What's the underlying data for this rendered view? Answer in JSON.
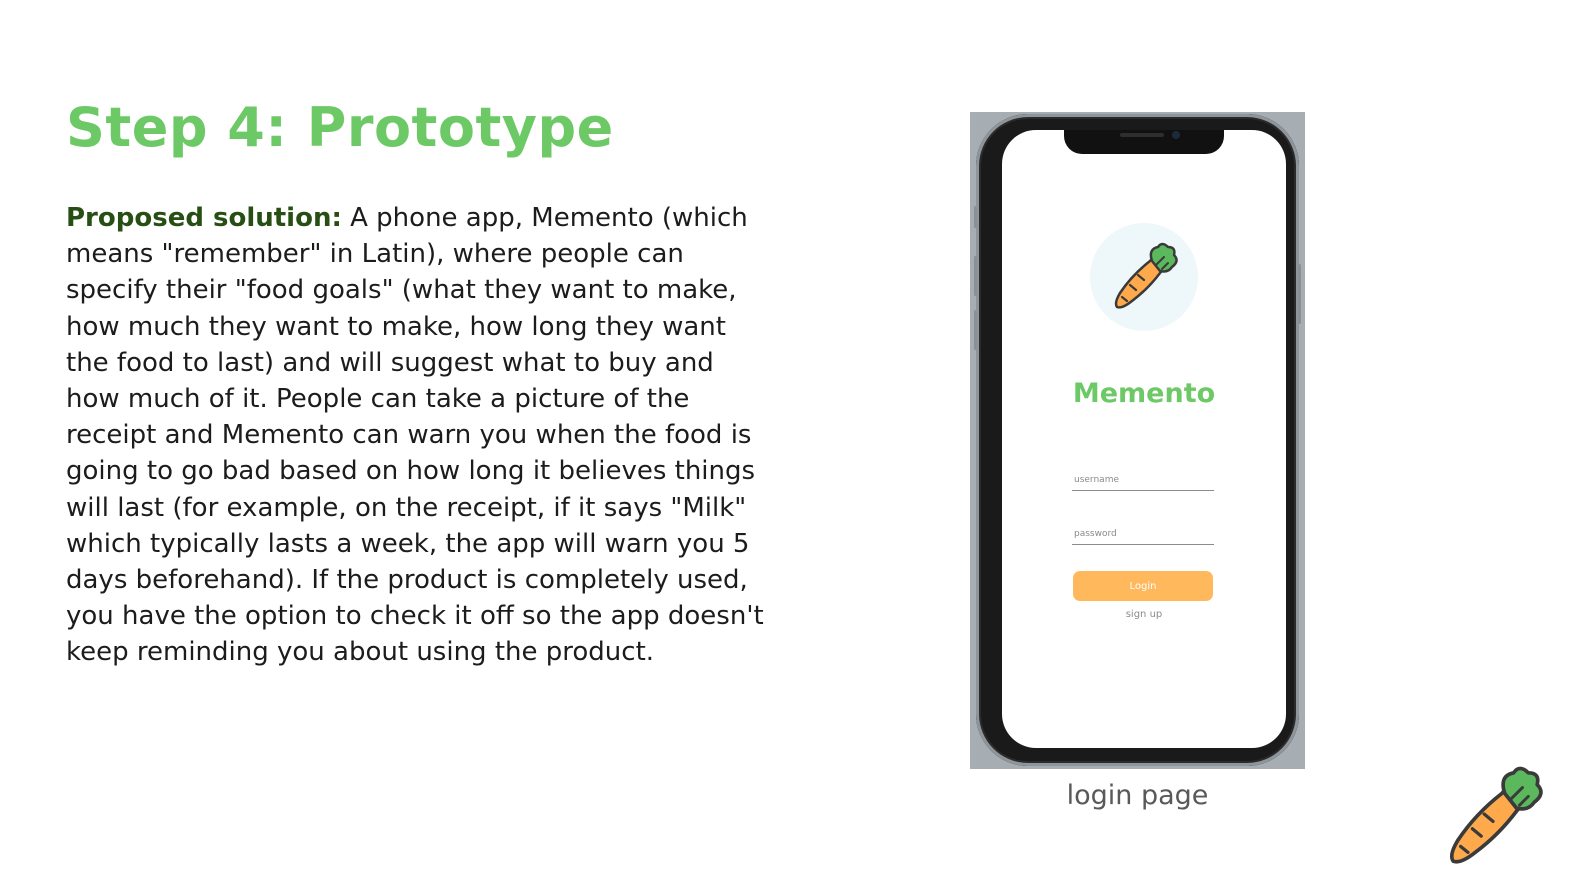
{
  "slide": {
    "title": "Step 4: Prototype",
    "body_lead": "Proposed solution:",
    "body_text": " A phone app, Memento (which means \"remember\" in Latin), where people can specify their \"food goals\" (what they want to make, how much they want to make, how long they want the food to last) and will suggest what to buy and how much of it. People can take a picture of the receipt and Memento can warn you when the food is going to go bad based on how long it believes things will last (for example, on the receipt, if it says \"Milk\" which typically lasts a week, the app will warn you 5 days beforehand). If the product is completely used, you have the option to check it off so the app doesn't keep reminding you about using the product.",
    "caption": "login page"
  },
  "phone_app": {
    "app_name": "Memento",
    "username_placeholder": "username",
    "password_placeholder": "password",
    "login_label": "Login",
    "signup_label": "sign up"
  },
  "colors": {
    "title_green": "#6dc966",
    "lead_green": "#274e13",
    "login_orange": "#ffb95c",
    "carrot_orange": "#ffa94d",
    "leaf_green": "#5cb85c"
  },
  "icons": {
    "logo": "carrot-icon",
    "corner": "carrot-icon"
  }
}
